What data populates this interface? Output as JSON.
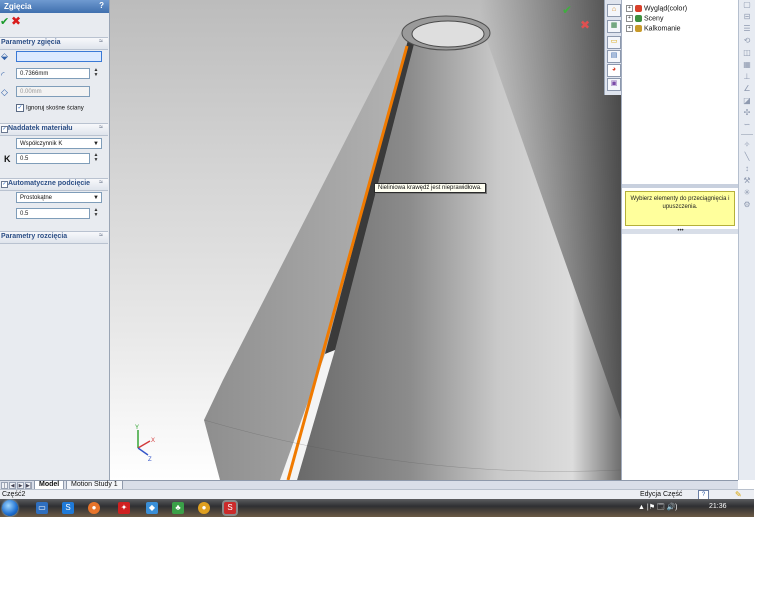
{
  "property_manager": {
    "title": "Zgięcia",
    "help_label": "?",
    "ok_label": "✔",
    "cancel_label": "✖",
    "sections": {
      "bend_params": {
        "label": "Parametry zgięcia",
        "collapse": "≈"
      },
      "material_allowance": {
        "label": "Naddatek materiału",
        "collapse": "≈"
      },
      "auto_relief": {
        "label": "Automatyczne podcięcie",
        "collapse": "≈"
      },
      "rip_params": {
        "label": "Parametry rozcięcia",
        "collapse": "≈"
      }
    },
    "fixed_face_value": "",
    "bend_radius_value": "0.7366mm",
    "thickness_value": "0.00mm",
    "ignore_beveled_label": "Ignoruj skośne ściany",
    "allowance_type": "Współczynnik K",
    "k_label": "K",
    "k_value": "0.5",
    "relief_type": "Prostokątne",
    "relief_ratio": "0.5"
  },
  "viewport": {
    "tooltip": "Nieliniowa krawędź jest nieprawidłowa.",
    "confirm_icon": "✔",
    "cancel_icon": "✖"
  },
  "task_pane": {
    "tree": [
      {
        "label": "Wygląd(color)",
        "icon_color": "#d8402a"
      },
      {
        "label": "Sceny",
        "icon_color": "#3f8f3f"
      },
      {
        "label": "Kalkomanie",
        "icon_color": "#c89a2a"
      }
    ],
    "message": "Wybierz elementy do przeciągnięcia i upuszczenia.",
    "splitter_dots": "•••"
  },
  "bottom_tabs": {
    "model": "Model",
    "motion": "Motion Study 1"
  },
  "status": {
    "left": "Część2",
    "right": "Edycja Część",
    "help": "?"
  },
  "taskbar": {
    "clock": "21:36",
    "tray": "▲ |⚑ 🗔 🔊)"
  },
  "colors": {
    "accent": "#3f6fae",
    "edge_highlight": "#f07a00",
    "tooltip_bg": "#fffff2",
    "message_bg": "#ffff9c"
  }
}
